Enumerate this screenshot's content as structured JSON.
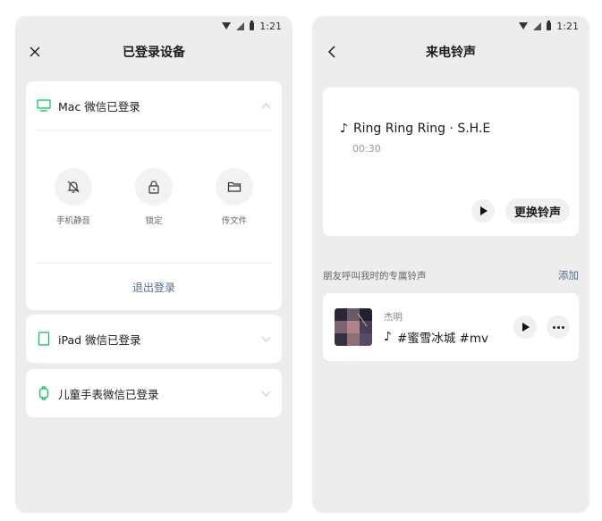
{
  "left": {
    "status_time": "1:21",
    "title": "已登录设备",
    "devices": [
      {
        "label": "Mac 微信已登录",
        "icon": "monitor-icon",
        "expanded": true
      },
      {
        "label": "iPad 微信已登录",
        "icon": "tablet-icon",
        "expanded": false
      },
      {
        "label": "儿童手表微信已登录",
        "icon": "watch-icon",
        "expanded": false
      }
    ],
    "actions": [
      {
        "label": "手机静音",
        "icon": "bell-off-icon"
      },
      {
        "label": "锁定",
        "icon": "lock-icon"
      },
      {
        "label": "传文件",
        "icon": "folder-icon"
      }
    ],
    "logout_label": "退出登录"
  },
  "right": {
    "status_time": "1:21",
    "title": "来电铃声",
    "current": {
      "note": "♪",
      "title": "Ring Ring Ring · S.H.E",
      "duration": "00:30",
      "change_label": "更换铃声"
    },
    "section_title": "朋友呼叫我时的专属铃声",
    "section_action": "添加",
    "friend": {
      "name": "杰明",
      "note": "♪",
      "song": "#蜜雪冰城 #mv"
    }
  },
  "colors": {
    "accent_link": "#576b95",
    "device_icon": "#07c160",
    "page_bg": "#ededed"
  }
}
